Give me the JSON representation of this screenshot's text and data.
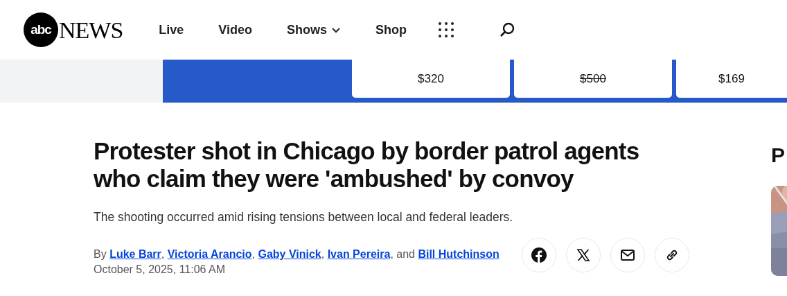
{
  "logo": {
    "mark": "abc",
    "word": "NEWS"
  },
  "nav": [
    {
      "label": "Live",
      "kind": "link"
    },
    {
      "label": "Video",
      "kind": "link"
    },
    {
      "label": "Shows",
      "kind": "dropdown"
    },
    {
      "label": "Shop",
      "kind": "link"
    }
  ],
  "promo": {
    "prices": [
      {
        "price": "$320",
        "struck": false
      },
      {
        "price": "$500",
        "struck": true
      },
      {
        "price": "$169",
        "struck": false
      }
    ]
  },
  "article": {
    "headline": "Protester shot in Chicago by border patrol agents who claim they were 'ambushed' by convoy",
    "subtitle": "The shooting occurred amid rising tensions between local and federal leaders.",
    "byline_prefix": "By",
    "authors": [
      {
        "name": "Luke Barr",
        "after": ", "
      },
      {
        "name": "Victoria Arancio",
        "after": ", "
      },
      {
        "name": "Gaby Vinick",
        "after": ", "
      },
      {
        "name": "Ivan Pereira",
        "after": ", and "
      },
      {
        "name": "Bill Hutchinson"
      }
    ],
    "date": "October 5, 2025, 11:06 AM",
    "share": [
      {
        "kind": "facebook"
      },
      {
        "kind": "x"
      },
      {
        "kind": "email"
      },
      {
        "kind": "link"
      }
    ]
  },
  "sidebar": {
    "heading": "P",
    "kind": "picture"
  }
}
